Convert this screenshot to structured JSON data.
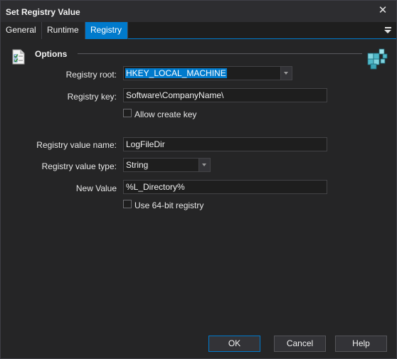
{
  "window": {
    "title": "Set Registry Value",
    "close_glyph": "✕"
  },
  "tabs": [
    {
      "label": "General",
      "active": false
    },
    {
      "label": "Runtime",
      "active": false
    },
    {
      "label": "Registry",
      "active": true
    }
  ],
  "colors": {
    "accent": "#007acc",
    "background": "#252526",
    "field_bg": "#1e1e1e"
  },
  "section": {
    "title": "Options",
    "icon": "checklist-icon",
    "right_icon": "registry-cubes-icon"
  },
  "form": {
    "registry_root": {
      "label": "Registry root:",
      "value": "HKEY_LOCAL_MACHINE"
    },
    "registry_key": {
      "label": "Registry key:",
      "value": "Software\\CompanyName\\"
    },
    "allow_create_key": {
      "label": "Allow create key",
      "checked": false
    },
    "registry_value_name": {
      "label": "Registry value name:",
      "value": "LogFileDir"
    },
    "registry_value_type": {
      "label": "Registry value type:",
      "value": "String"
    },
    "new_value": {
      "label": "New Value",
      "value": "%L_Directory%"
    },
    "use_64bit": {
      "label": "Use 64-bit registry",
      "checked": false
    }
  },
  "buttons": {
    "ok": "OK",
    "cancel": "Cancel",
    "help": "Help"
  }
}
